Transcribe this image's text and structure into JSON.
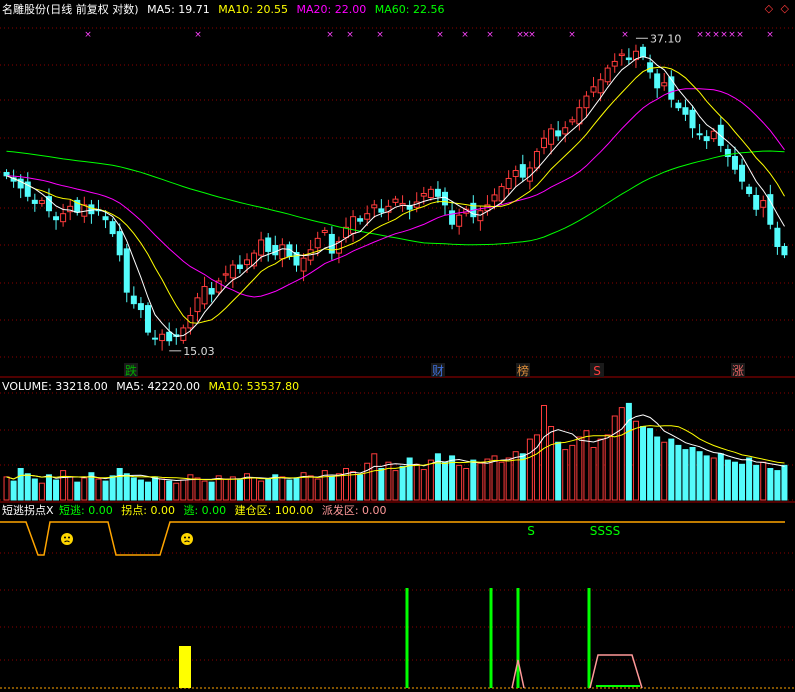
{
  "colors": {
    "bg": "#000000",
    "grid": "#8b0000",
    "up": "#ff3c3c",
    "down": "#54fcfc",
    "ma5": "#ffffff",
    "ma10": "#ffff00",
    "ma20": "#ff00ff",
    "ma60": "#00ff00",
    "white": "#ffffff",
    "yellow": "#ffff00",
    "orange": "#ffa500",
    "green": "#00ff00",
    "salmon": "#ff9999",
    "event_blue": "#3e6fd8",
    "event_red": "#e06060"
  },
  "corner_icons": "◇ ◇",
  "price_header": {
    "title": "名雕股份(日线 前复权 对数)",
    "ma5": "MA5: 19.71",
    "ma10": "MA10: 20.55",
    "ma20": "MA20: 22.00",
    "ma60": "MA60: 22.56"
  },
  "price_labels": {
    "high": "37.10",
    "low": "15.03"
  },
  "events": [
    {
      "label": "跌",
      "color": "#00aa00"
    },
    {
      "label": "财",
      "color": "#3e6fd8"
    },
    {
      "label": "榜",
      "color": "#d98c3a"
    },
    {
      "label": "S",
      "color": "#ff3c3c"
    },
    {
      "label": "涨",
      "color": "#e06060"
    }
  ],
  "volume_header": {
    "title": "VOLUME: 33218.00",
    "ma5": "MA5: 42220.00",
    "ma10": "MA10: 53537.80"
  },
  "indicator_header": {
    "title": "短逃拐点X",
    "short_escape": "短逃: 0.00",
    "turn_point": "拐点: 0.00",
    "escape": "逃: 0.00",
    "build": "建仓区: 100.00",
    "distribute": "派发区: 0.00"
  },
  "indicator_markers": {
    "s_single": "S",
    "s_multi": "SSSS"
  },
  "chart_data": [
    {
      "type": "candlestick",
      "title": "名雕股份(日线 前复权 对数)",
      "log_scale": true,
      "ylim": [
        14,
        40
      ],
      "series": [
        {
          "name": "MA5",
          "last": 19.71
        },
        {
          "name": "MA10",
          "last": 20.55
        },
        {
          "name": "MA20",
          "last": 22.0
        },
        {
          "name": "MA60",
          "last": 22.56
        }
      ],
      "annotations": [
        {
          "text": "37.10",
          "kind": "period high"
        },
        {
          "text": "15.03",
          "kind": "period low"
        }
      ],
      "close_series": [
        25.0,
        24.6,
        24.1,
        23.5,
        23.0,
        23.2,
        22.5,
        21.9,
        22.3,
        22.8,
        22.4,
        22.9,
        22.3,
        22.5,
        21.9,
        21.0,
        19.7,
        17.6,
        17.0,
        16.7,
        15.6,
        15.3,
        15.5,
        15.2,
        15.4,
        15.8,
        16.4,
        17.3,
        17.9,
        17.5,
        18.2,
        18.6,
        19.1,
        18.9,
        19.4,
        19.8,
        20.6,
        19.9,
        19.7,
        20.3,
        19.6,
        19.1,
        19.5,
        20.0,
        20.7,
        21.2,
        19.8,
        20.5,
        21.4,
        22.1,
        21.8,
        22.3,
        22.9,
        22.4,
        22.8,
        23.3,
        23.0,
        22.6,
        23.1,
        23.7,
        24.0,
        23.5,
        22.9,
        21.6,
        22.2,
        22.6,
        22.1,
        22.5,
        22.9,
        23.6,
        24.2,
        24.8,
        25.4,
        24.9,
        25.6,
        26.9,
        28.0,
        28.8,
        28.2,
        28.9,
        29.6,
        30.7,
        31.8,
        32.7,
        33.4,
        34.6,
        35.3,
        36.1,
        35.5,
        36.4,
        35.8,
        34.2,
        32.6,
        33.1,
        31.5,
        30.7,
        30.1,
        28.9,
        28.3,
        27.8,
        28.6,
        27.4,
        26.5,
        25.5,
        24.6,
        23.7,
        22.6,
        23.2,
        21.6,
        20.2,
        19.7
      ]
    },
    {
      "type": "bar",
      "title": "VOLUME",
      "series": [
        {
          "name": "VOLUME",
          "last": 33218.0
        },
        {
          "name": "MA5",
          "last": 42220.0
        },
        {
          "name": "MA10",
          "last": 53537.8
        }
      ],
      "values": [
        22,
        18,
        30,
        25,
        20,
        16,
        24,
        19,
        28,
        22,
        17,
        21,
        26,
        20,
        18,
        23,
        30,
        25,
        21,
        19,
        17,
        22,
        20,
        18,
        16,
        19,
        24,
        21,
        18,
        17,
        23,
        20,
        22,
        19,
        25,
        21,
        18,
        20,
        24,
        22,
        19,
        21,
        26,
        23,
        20,
        28,
        22,
        25,
        30,
        27,
        24,
        35,
        44,
        30,
        36,
        28,
        32,
        40,
        34,
        29,
        38,
        44,
        36,
        42,
        33,
        30,
        38,
        35,
        39,
        42,
        36,
        40,
        46,
        44,
        58,
        62,
        90,
        70,
        55,
        48,
        52,
        60,
        66,
        50,
        58,
        62,
        80,
        88,
        92,
        75,
        70,
        68,
        60,
        55,
        58,
        52,
        48,
        50,
        46,
        42,
        40,
        44,
        38,
        36,
        34,
        40,
        33,
        36,
        30,
        28,
        33
      ]
    },
    {
      "type": "line",
      "title": "短逃拐点X",
      "series": [
        {
          "name": "短逃",
          "last": 0.0
        },
        {
          "name": "拐点",
          "last": 0.0
        },
        {
          "name": "逃",
          "last": 0.0
        },
        {
          "name": "建仓区",
          "last": 100.0
        },
        {
          "name": "派发区",
          "last": 0.0
        }
      ]
    }
  ]
}
